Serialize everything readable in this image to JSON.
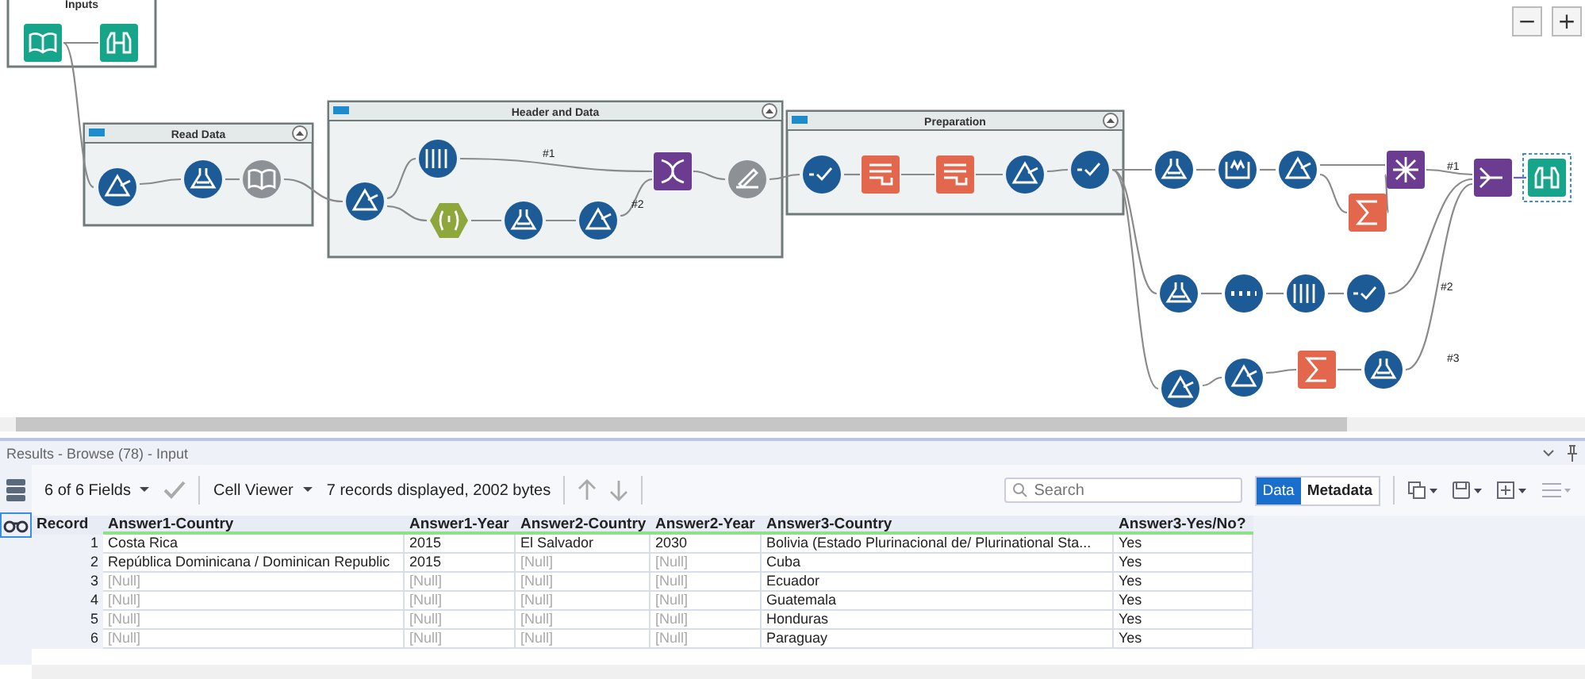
{
  "canvas": {
    "containers": [
      {
        "title": "Inputs",
        "collapsible": false
      },
      {
        "title": "Read Data",
        "collapsible": true
      },
      {
        "title": "Header and Data",
        "collapsible": true
      },
      {
        "title": "Preparation",
        "collapsible": true
      }
    ],
    "connection_labels": [
      "#1",
      "#2",
      "#1",
      "#2",
      "#3"
    ],
    "zoom_buttons": [
      "−",
      "+"
    ]
  },
  "results": {
    "title": "Results - Browse (78) - Input",
    "toolbar": {
      "fields": "6 of 6 Fields",
      "viewer": "Cell Viewer",
      "summary": "7 records displayed, 2002 bytes",
      "search": {
        "placeholder": "Search"
      },
      "views": [
        {
          "label": "Data",
          "selected": true
        },
        {
          "label": "Metadata",
          "selected": false
        }
      ]
    },
    "table": {
      "record_header": "Record",
      "columns": [
        "Answer1-Country",
        "Answer1-Year",
        "Answer2-Country",
        "Answer2-Year",
        "Answer3-Country",
        "Answer3-Yes/No?"
      ],
      "rows": [
        {
          "record": "1",
          "cells": [
            {
              "text": "Costa Rica",
              "null": false
            },
            {
              "text": "2015",
              "null": false
            },
            {
              "text": "El Salvador",
              "null": false
            },
            {
              "text": "2030",
              "null": false
            },
            {
              "text": "Bolivia (Estado Plurinacional de/ Plurinational Sta...",
              "null": false
            },
            {
              "text": "Yes",
              "null": false
            }
          ]
        },
        {
          "record": "2",
          "cells": [
            {
              "text": "República Dominicana / Dominican Republic",
              "null": false
            },
            {
              "text": "2015",
              "null": false
            },
            {
              "text": "[Null]",
              "null": true
            },
            {
              "text": "[Null]",
              "null": true
            },
            {
              "text": "Cuba",
              "null": false
            },
            {
              "text": "Yes",
              "null": false
            }
          ]
        },
        {
          "record": "3",
          "cells": [
            {
              "text": "[Null]",
              "null": true
            },
            {
              "text": "[Null]",
              "null": true
            },
            {
              "text": "[Null]",
              "null": true
            },
            {
              "text": "[Null]",
              "null": true
            },
            {
              "text": "Ecuador",
              "null": false
            },
            {
              "text": "Yes",
              "null": false
            }
          ]
        },
        {
          "record": "4",
          "cells": [
            {
              "text": "[Null]",
              "null": true
            },
            {
              "text": "[Null]",
              "null": true
            },
            {
              "text": "[Null]",
              "null": true
            },
            {
              "text": "[Null]",
              "null": true
            },
            {
              "text": "Guatemala",
              "null": false
            },
            {
              "text": "Yes",
              "null": false
            }
          ]
        },
        {
          "record": "5",
          "cells": [
            {
              "text": "[Null]",
              "null": true
            },
            {
              "text": "[Null]",
              "null": true
            },
            {
              "text": "[Null]",
              "null": true
            },
            {
              "text": "[Null]",
              "null": true
            },
            {
              "text": "Honduras",
              "null": false
            },
            {
              "text": "Yes",
              "null": false
            }
          ]
        },
        {
          "record": "6",
          "cells": [
            {
              "text": "[Null]",
              "null": true
            },
            {
              "text": "[Null]",
              "null": true
            },
            {
              "text": "[Null]",
              "null": true
            },
            {
              "text": "[Null]",
              "null": true
            },
            {
              "text": "Paraguay",
              "null": false
            },
            {
              "text": "Yes",
              "null": false
            }
          ]
        }
      ]
    }
  }
}
